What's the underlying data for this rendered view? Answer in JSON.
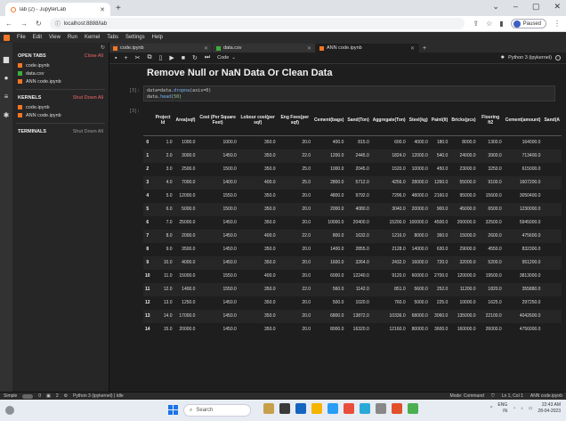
{
  "browser": {
    "tab_title": "lab (2) - JupyterLab",
    "url": "localhost:8888/lab",
    "profile_label": "Paused"
  },
  "menu": [
    "File",
    "Edit",
    "View",
    "Run",
    "Kernel",
    "Tabs",
    "Settings",
    "Help"
  ],
  "sidebar": {
    "open_tabs_title": "OPEN TABS",
    "open_tabs_action": "Close All",
    "open_tabs": [
      {
        "name": "code.ipynb",
        "type": "notebook"
      },
      {
        "name": "data.csv",
        "type": "csv"
      },
      {
        "name": "ANN code.ipynb",
        "type": "notebook"
      }
    ],
    "kernels_title": "KERNELS",
    "kernels_action": "Shut Down All",
    "kernels": [
      {
        "name": "code.ipynb"
      },
      {
        "name": "ANN code.ipynb"
      }
    ],
    "terminals_title": "TERMINALS",
    "terminals_action": "Shut Down All"
  },
  "doc_tabs": [
    {
      "label": "code.ipynb"
    },
    {
      "label": "data.csv"
    },
    {
      "label": "ANN code.ipynb"
    }
  ],
  "toolbar": {
    "cell_type": "Code",
    "kernel": "Python 3 (ipykernel)"
  },
  "notebook": {
    "heading": "Remove Null or NaN Data Or Clean Data",
    "code_prompt": "[3]:",
    "code_line1_pre": "data=data.",
    "code_line1_fn": "dropna",
    "code_line1_post": "(axis=0)",
    "code_line2_pre": "data.",
    "code_line2_fn": "head",
    "code_line2_post": "(",
    "code_line2_num": "50",
    "code_line2_end": ")",
    "output_prompt": "[3]:"
  },
  "table": {
    "columns": [
      "",
      "Project Id",
      "Area(sqf)",
      "Cost (Per Square Feet)",
      "Lobour cost(per sqf)",
      "Eng Fees(per sqf)",
      "Cement(bags)",
      "Sand(Ton)",
      "Aggregate(Ton)",
      "Steel(kg)",
      "Paint(lt)",
      "Bricks(pcs)",
      "Flooring ft2",
      "Cement(amount)",
      "Sand(A"
    ],
    "rows": [
      [
        "0",
        "1.0",
        "1000.0",
        "1000.0",
        "350.0",
        "20.0",
        "400.0",
        "815.0",
        "600.0",
        "4000.0",
        "180.0",
        "8000.0",
        "1300.0",
        "164000.0",
        ""
      ],
      [
        "1",
        "2.0",
        "3000.0",
        "1450.0",
        "350.0",
        "22.0",
        "1200.0",
        "2445.0",
        "1824.0",
        "12000.0",
        "540.0",
        "24000.0",
        "3900.0",
        "713400.0",
        ""
      ],
      [
        "2",
        "3.0",
        "2500.0",
        "1500.0",
        "350.0",
        "25.0",
        "1000.0",
        "2045.0",
        "1520.0",
        "10000.0",
        "450.0",
        "23000.0",
        "3250.0",
        "615000.0",
        ""
      ],
      [
        "3",
        "4.0",
        "7000.0",
        "1400.0",
        "400.0",
        "25.0",
        "2800.0",
        "5712.0",
        "4256.0",
        "28000.0",
        "1260.0",
        "55000.0",
        "9100.0",
        "1607200.0",
        ""
      ],
      [
        "4",
        "5.0",
        "12000.0",
        "1550.0",
        "350.0",
        "20.0",
        "4800.0",
        "9792.0",
        "7296.0",
        "48000.0",
        "2160.0",
        "95000.0",
        "15600.0",
        "3050400.0",
        ""
      ],
      [
        "5",
        "6.0",
        "5000.0",
        "1500.0",
        "350.0",
        "20.0",
        "2000.0",
        "4080.0",
        "3040.0",
        "20000.0",
        "900.0",
        "45000.0",
        "6500.0",
        "1230000.0",
        ""
      ],
      [
        "6",
        "7.0",
        "25000.0",
        "1450.0",
        "350.0",
        "20.0",
        "10000.0",
        "20400.0",
        "15200.0",
        "100000.0",
        "4500.0",
        "200000.0",
        "32500.0",
        "5945000.0",
        ""
      ],
      [
        "7",
        "8.0",
        "2000.0",
        "1450.0",
        "400.0",
        "22.0",
        "800.0",
        "1632.0",
        "1216.0",
        "8000.0",
        "360.0",
        "15000.0",
        "2600.0",
        "475600.0",
        ""
      ],
      [
        "8",
        "9.0",
        "3500.0",
        "1450.0",
        "350.0",
        "20.0",
        "1400.0",
        "2855.0",
        "2128.0",
        "14000.0",
        "630.0",
        "29000.0",
        "4550.0",
        "832300.0",
        ""
      ],
      [
        "9",
        "10.0",
        "4000.0",
        "1450.0",
        "350.0",
        "20.0",
        "1600.0",
        "3264.0",
        "2432.0",
        "16000.0",
        "720.0",
        "32000.0",
        "5200.0",
        "951200.0",
        ""
      ],
      [
        "10",
        "11.0",
        "15000.0",
        "1550.0",
        "400.0",
        "20.0",
        "6000.0",
        "12240.0",
        "9120.0",
        "60000.0",
        "2700.0",
        "120000.0",
        "19500.0",
        "3813000.0",
        ""
      ],
      [
        "11",
        "12.0",
        "1400.0",
        "1550.0",
        "350.0",
        "22.0",
        "560.0",
        "1142.0",
        "851.0",
        "5600.0",
        "252.0",
        "11200.0",
        "1820.0",
        "355880.0",
        ""
      ],
      [
        "12",
        "13.0",
        "1250.0",
        "1450.0",
        "350.0",
        "20.0",
        "500.0",
        "1020.0",
        "760.0",
        "5000.0",
        "225.0",
        "10000.0",
        "1625.0",
        "297250.0",
        ""
      ],
      [
        "13",
        "14.0",
        "17000.0",
        "1450.0",
        "350.0",
        "20.0",
        "6800.0",
        "13872.0",
        "10336.0",
        "68000.0",
        "3060.0",
        "135000.0",
        "22100.0",
        "4042600.0",
        ""
      ],
      [
        "14",
        "15.0",
        "20000.0",
        "1450.0",
        "350.0",
        "20.0",
        "8000.0",
        "16320.0",
        "12160.0",
        "80000.0",
        "3600.0",
        "160000.0",
        "26000.0",
        "4756000.0",
        ""
      ]
    ]
  },
  "statusbar": {
    "mode_label": "Simple",
    "count1": "0",
    "count2": "2",
    "kernel_status": "Python 3 (ipykernel) | Idle",
    "mode": "Mode: Command",
    "position": "Ln 1, Col 1",
    "file": "ANN code.ipynb"
  },
  "taskbar": {
    "search_placeholder": "Search",
    "lang_line1": "ENG",
    "lang_line2": "IN",
    "time": "22:43 AM",
    "date": "28-04-2023"
  },
  "colors": {
    "accent": "#f37626",
    "csv": "#3cae3c",
    "kernel_action": "#e66666"
  }
}
